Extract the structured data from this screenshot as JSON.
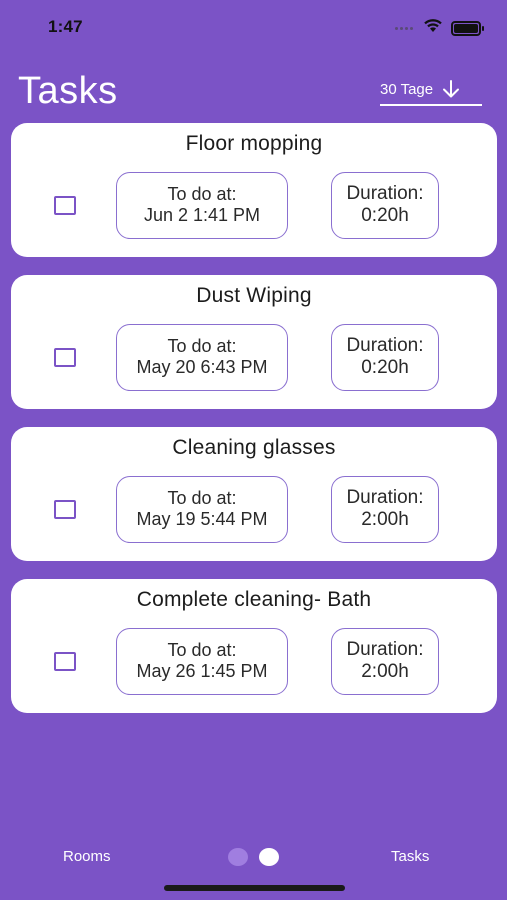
{
  "status_bar": {
    "time": "1:47",
    "icons": [
      "signal-dots-icon",
      "wifi-icon",
      "battery-icon"
    ]
  },
  "header": {
    "title": "Tasks",
    "range_label": "30 Tage",
    "range_icon": "arrow-down-icon"
  },
  "tasks": [
    {
      "title": "Floor mopping",
      "todo_label": "To do at:",
      "todo_date": "Jun 2 1:41 PM",
      "duration_label": "Duration:",
      "duration": "0:20h",
      "checked": false
    },
    {
      "title": "Dust Wiping",
      "todo_label": "To do at:",
      "todo_date": "May 20 6:43 PM",
      "duration_label": "Duration:",
      "duration": "0:20h",
      "checked": false
    },
    {
      "title": "Cleaning glasses",
      "todo_label": "To do at:",
      "todo_date": "May 19 5:44 PM",
      "duration_label": "Duration:",
      "duration": "2:00h",
      "checked": false
    },
    {
      "title": "Complete cleaning- Bath",
      "todo_label": "To do at:",
      "todo_date": "May 26 1:45 PM",
      "duration_label": "Duration:",
      "duration": "2:00h",
      "checked": false
    }
  ],
  "tab_bar": {
    "left_label": "Rooms",
    "right_label": "Tasks",
    "page_count": 2,
    "active_page": 2
  },
  "colors": {
    "background": "#7b53c6",
    "card": "#ffffff",
    "accent": "#8a6fd0",
    "dot_inactive": "#a07ee0"
  }
}
